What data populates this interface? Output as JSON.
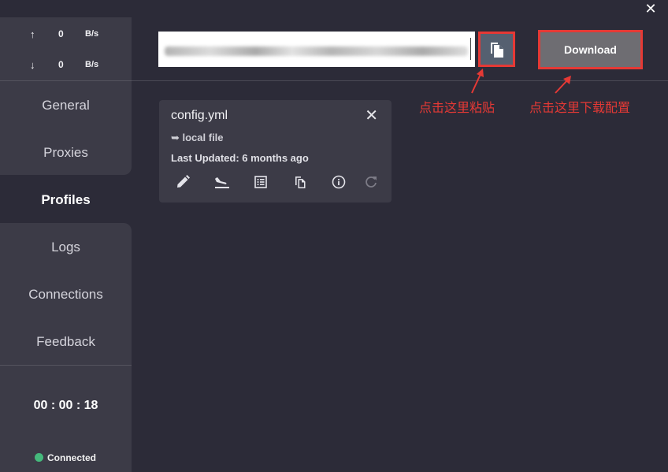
{
  "window": {
    "close_glyph": "✕"
  },
  "sidebar": {
    "upload": {
      "arrow": "↑",
      "value": "0",
      "unit": "B/s"
    },
    "download": {
      "arrow": "↓",
      "value": "0",
      "unit": "B/s"
    },
    "nav": [
      {
        "label": "General"
      },
      {
        "label": "Proxies"
      },
      {
        "label": "Profiles",
        "active": true
      },
      {
        "label": "Logs"
      },
      {
        "label": "Connections"
      },
      {
        "label": "Feedback"
      }
    ],
    "timer": "00 : 00 : 18",
    "status": "Connected",
    "status_color": "#45b97c"
  },
  "toolbar": {
    "url_value": "",
    "paste_icon": "copy-icon",
    "download_label": "Download"
  },
  "annotations": {
    "paste_hint": "点击这里粘贴",
    "download_hint": "点击这里下载配置",
    "color": "#e53935"
  },
  "profile_card": {
    "name": "config.yml",
    "source": "➥ local file",
    "updated": "Last Updated: 6 months ago",
    "close_glyph": "✕",
    "actions": [
      "edit-icon",
      "flight-land-icon",
      "list-icon",
      "copy-icon",
      "info-icon",
      "refresh-icon"
    ]
  }
}
